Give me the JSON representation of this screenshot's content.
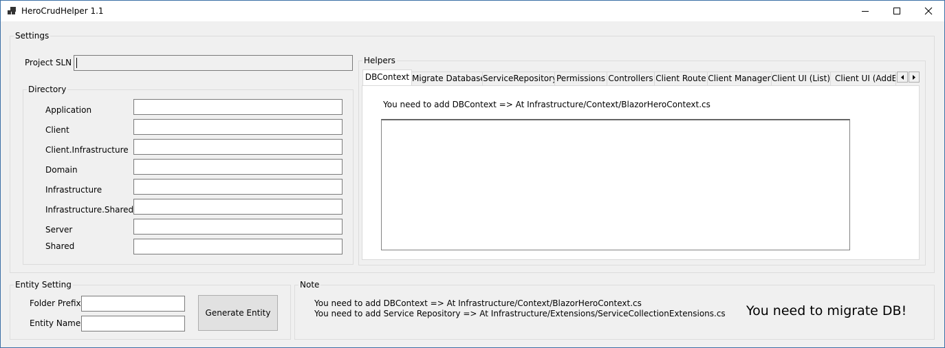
{
  "window": {
    "title": "HeroCrudHelper 1.1"
  },
  "settings": {
    "group_label": "Settings",
    "project_sln_label": "Project SLN",
    "project_sln_value": "",
    "directory": {
      "group_label": "Directory",
      "fields": [
        {
          "label": "Application",
          "value": ""
        },
        {
          "label": "Client",
          "value": ""
        },
        {
          "label": "Client.Infrastructure",
          "value": ""
        },
        {
          "label": "Domain",
          "value": ""
        },
        {
          "label": "Infrastructure",
          "value": ""
        },
        {
          "label": "Infrastructure.Shared",
          "value": ""
        },
        {
          "label": "Server",
          "value": ""
        },
        {
          "label": "Shared",
          "value": ""
        }
      ]
    },
    "helpers": {
      "group_label": "Helpers",
      "tabs": [
        "DBContext",
        "Migrate Database",
        "ServiceRepository",
        "Permissions",
        "Controllers",
        "Client Route",
        "Client Manager",
        "Client UI (List)",
        "Client UI (AddEd"
      ],
      "active_tab": "DBContext",
      "instruction": "You need to add DBContext => At Infrastructure/Context/BlazorHeroContext.cs",
      "code_text": ""
    }
  },
  "entity_setting": {
    "group_label": "Entity Setting",
    "folder_prefix_label": "Folder Prefix",
    "folder_prefix_value": "",
    "entity_name_label": "Entity Name",
    "entity_name_value": "",
    "generate_button": "Generate Entity"
  },
  "note": {
    "group_label": "Note",
    "line1": "You need to add DBContext => At Infrastructure/Context/BlazorHeroContext.cs",
    "line2": "You need to add Service Repository => At Infrastructure/Extensions/ServiceCollectionExtensions.cs",
    "status": "You need to migrate DB!"
  }
}
